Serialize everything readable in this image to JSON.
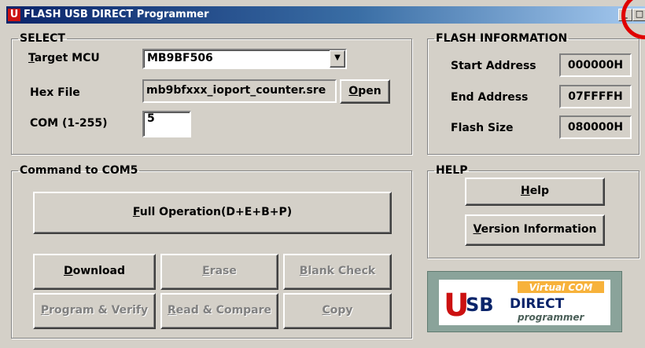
{
  "window": {
    "title": "FLASH USB DIRECT Programmer",
    "app_icon_letter": "U"
  },
  "select": {
    "legend": "SELECT",
    "target_mcu": {
      "label_key": "T",
      "label_rest": "arget MCU",
      "value": "MB9BF506"
    },
    "hex_file": {
      "label": "Hex File",
      "value": "mb9bfxxx_ioport_counter.sre",
      "open_key": "O",
      "open_rest": "pen"
    },
    "com": {
      "label": "COM (1-255)",
      "value": "5"
    }
  },
  "flash_info": {
    "legend": "FLASH INFORMATION",
    "start_label": "Start Address",
    "start_value": "000000H",
    "end_label": "End Address",
    "end_value": "07FFFFH",
    "size_label": "Flash Size",
    "size_value": "080000H"
  },
  "command": {
    "legend": "Command to  COM5",
    "full_key": "F",
    "full_rest": "ull Operation(D+E+B+P)",
    "download_key": "D",
    "download_rest": "ownload",
    "erase_key": "E",
    "erase_rest": "rase",
    "blank_key": "B",
    "blank_rest": "lank Check",
    "program_key": "P",
    "program_rest": "rogram & Verify",
    "read_key": "R",
    "read_rest": "ead & Compare",
    "copy_key": "C",
    "copy_rest": "opy"
  },
  "help": {
    "legend": "HELP",
    "help_key": "H",
    "help_rest": "elp",
    "version_key": "V",
    "version_rest": "ersion Information"
  },
  "logo": {
    "line1": "Virtual COM",
    "big_u": "U",
    "sb": "SB",
    "direct": "DIRECT",
    "programmer": "programmer"
  },
  "colors": {
    "title_start": "#0a246a",
    "title_end": "#a6caf0",
    "face": "#d4d0c8",
    "highlight": "#e00000"
  }
}
